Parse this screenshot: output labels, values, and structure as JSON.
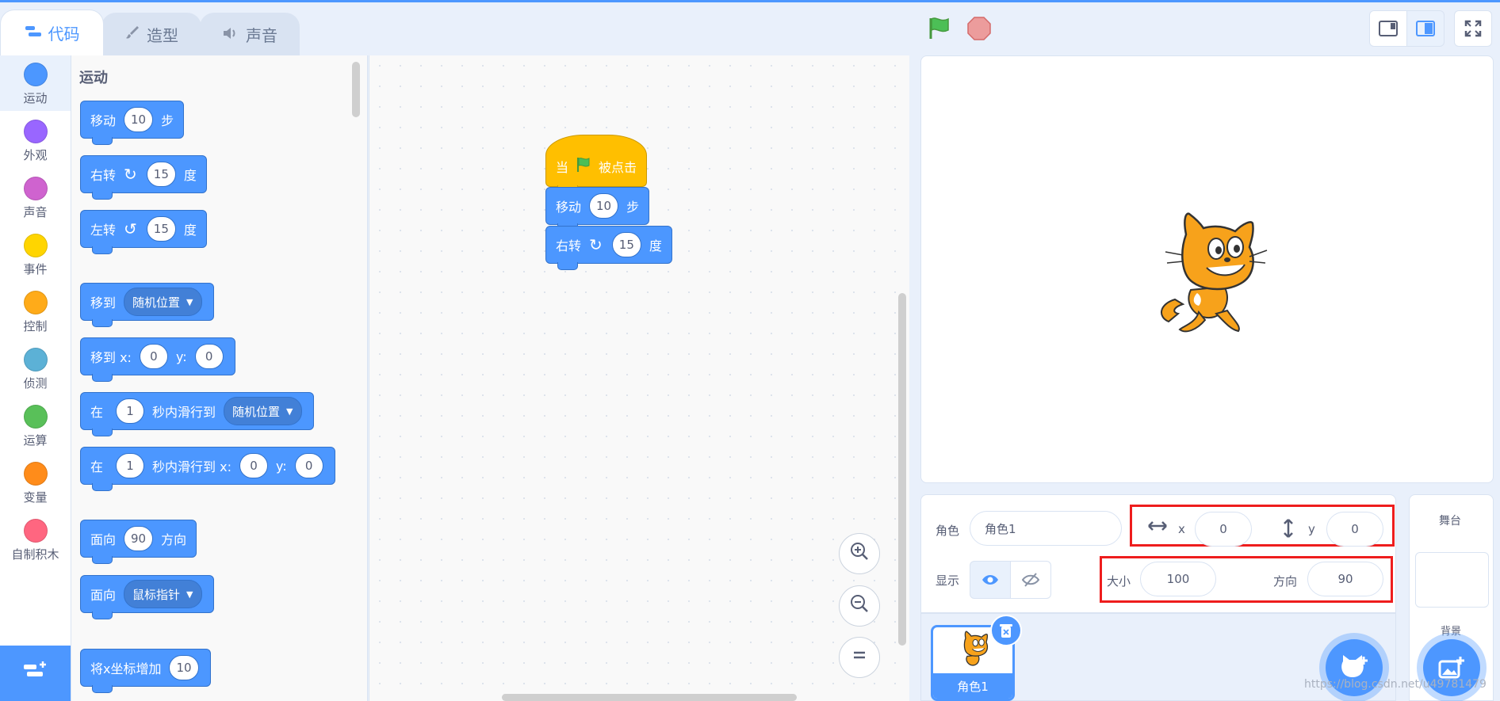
{
  "tabs": [
    {
      "label": "代码",
      "icon": "code-icon"
    },
    {
      "label": "造型",
      "icon": "brush-icon"
    },
    {
      "label": "声音",
      "icon": "speaker-icon"
    }
  ],
  "categories": [
    {
      "label": "运动",
      "color": "#4c97ff"
    },
    {
      "label": "外观",
      "color": "#9966ff"
    },
    {
      "label": "声音",
      "color": "#cf63cf"
    },
    {
      "label": "事件",
      "color": "#ffd500"
    },
    {
      "label": "控制",
      "color": "#ffab19"
    },
    {
      "label": "侦测",
      "color": "#5cb1d6"
    },
    {
      "label": "运算",
      "color": "#59c059"
    },
    {
      "label": "变量",
      "color": "#ff8c1a"
    },
    {
      "label": "自制积木",
      "color": "#ff6680"
    }
  ],
  "palette": {
    "title": "运动",
    "move": {
      "label": "移动",
      "value": "10",
      "unit": "步"
    },
    "turn_right": {
      "label": "右转",
      "value": "15",
      "unit": "度"
    },
    "turn_left": {
      "label": "左转",
      "value": "15",
      "unit": "度"
    },
    "goto": {
      "label": "移到",
      "option": "随机位置"
    },
    "goto_xy": {
      "label": "移到 x:",
      "x": "0",
      "ylabel": "y:",
      "y": "0"
    },
    "glide": {
      "prefix": "在",
      "secs": "1",
      "mid": "秒内滑行到",
      "option": "随机位置"
    },
    "glide_xy": {
      "prefix": "在",
      "secs": "1",
      "mid": "秒内滑行到 x:",
      "x": "0",
      "ylabel": "y:",
      "y": "0"
    },
    "point_dir": {
      "label": "面向",
      "value": "90",
      "unit": "方向"
    },
    "point_towards": {
      "label": "面向",
      "option": "鼠标指针"
    },
    "change_x": {
      "label": "将x坐标增加",
      "value": "10"
    }
  },
  "script": {
    "hat": {
      "before": "当",
      "after": "被点击"
    },
    "move": {
      "label": "移动",
      "value": "10",
      "unit": "步"
    },
    "turn": {
      "label": "右转",
      "value": "15",
      "unit": "度"
    }
  },
  "sprite_info": {
    "sprite_label": "角色",
    "sprite_name": "角色1",
    "x_label": "x",
    "x": "0",
    "y_label": "y",
    "y": "0",
    "show_label": "显示",
    "size_label": "大小",
    "size": "100",
    "direction_label": "方向",
    "direction": "90"
  },
  "sprite_list": {
    "items": [
      {
        "name": "角色1"
      }
    ]
  },
  "stage_pane": {
    "title": "舞台",
    "backdrops_label": "背景"
  },
  "watermark": "https://blog.csdn.net/u49781479"
}
